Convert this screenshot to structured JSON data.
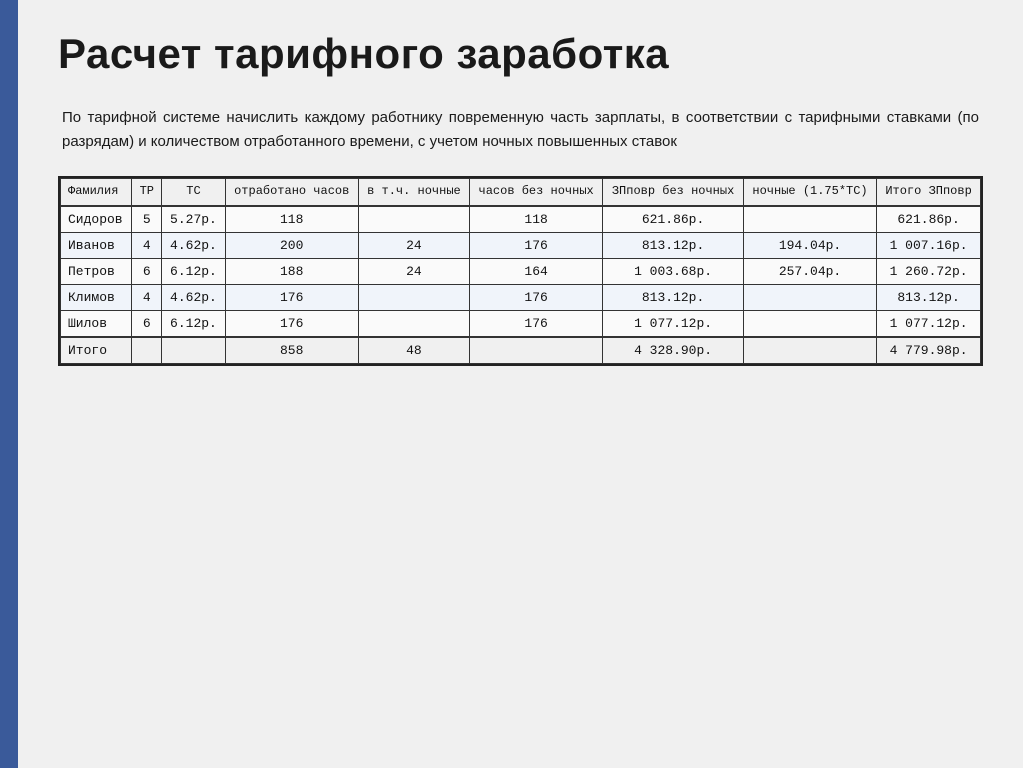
{
  "page": {
    "title": "Расчет тарифного заработка",
    "description": "По тарифной системе начислить каждому работнику повременную часть зарплаты, в соответствии с тарифными ставками (по разрядам) и количеством отработанного времени, с учетом ночных повышенных ставок"
  },
  "table": {
    "headers": [
      "Фамилия",
      "ТР",
      "ТС",
      "отработано часов",
      "в т.ч. ночные",
      "часов без ночных",
      "ЗПповр без ночных",
      "ночные (1.75*ТС)",
      "Итого ЗПповр"
    ],
    "rows": [
      [
        "Сидоров",
        "5",
        "5.27р.",
        "118",
        "",
        "118",
        "621.86р.",
        "",
        "621.86р."
      ],
      [
        "Иванов",
        "4",
        "4.62р.",
        "200",
        "24",
        "176",
        "813.12р.",
        "194.04р.",
        "1 007.16р."
      ],
      [
        "Петров",
        "6",
        "6.12р.",
        "188",
        "24",
        "164",
        "1 003.68р.",
        "257.04р.",
        "1 260.72р."
      ],
      [
        "Климов",
        "4",
        "4.62р.",
        "176",
        "",
        "176",
        "813.12р.",
        "",
        "813.12р."
      ],
      [
        "Шилов",
        "6",
        "6.12р.",
        "176",
        "",
        "176",
        "1 077.12р.",
        "",
        "1 077.12р."
      ]
    ],
    "total_row": [
      "Итого",
      "",
      "",
      "858",
      "48",
      "",
      "4 328.90р.",
      "",
      "4 779.98р."
    ]
  }
}
